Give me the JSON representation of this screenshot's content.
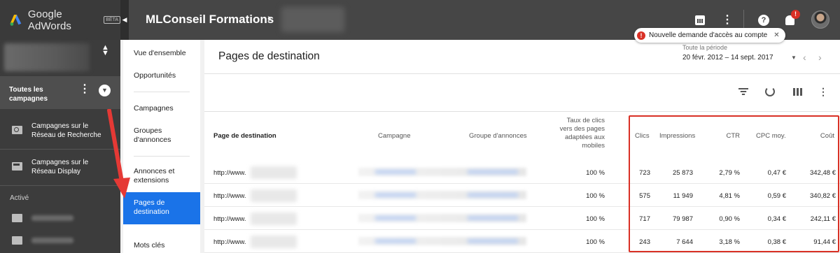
{
  "brand": {
    "name": "Google AdWords",
    "badge": "BÊTA"
  },
  "left_nav": {
    "all_campaigns": "Toutes les campagnes",
    "items": [
      {
        "label": "Campagnes sur le Réseau de Recherche",
        "icon": "search-network-icon"
      },
      {
        "label": "Campagnes sur le Réseau Display",
        "icon": "display-network-icon"
      }
    ],
    "active_section": "Activé"
  },
  "topbar": {
    "account_name": "MLConseil Formations",
    "notification_count": "!",
    "help_label": "?"
  },
  "notification": {
    "text": "Nouvelle demande d'accès au compte"
  },
  "sub_nav": {
    "items": [
      "Vue d'ensemble",
      "Opportunités",
      "Campagnes",
      "Groupes d'annonces",
      "Annonces et extensions",
      "Pages de destination",
      "Mots clés"
    ],
    "active": "Pages de destination"
  },
  "main": {
    "title": "Pages de destination",
    "period_label": "Toute la période",
    "period_value": "20 févr. 2012 – 14 sept. 2017"
  },
  "table": {
    "headers": {
      "page": "Page de destination",
      "campaign": "Campagne",
      "adgroup": "Groupe d'annonces",
      "mobile_ctr": "Taux de clics vers des pages adaptées aux mobiles",
      "clicks": "Clics",
      "impressions": "Impressions",
      "ctr": "CTR",
      "cpc": "CPC moy.",
      "cost": "Coût"
    },
    "rows": [
      {
        "url": "http://www.",
        "mobile": "100 %",
        "clicks": "723",
        "impressions": "25 873",
        "ctr": "2,79 %",
        "cpc": "0,47 €",
        "cost": "342,48 €"
      },
      {
        "url": "http://www.",
        "mobile": "100 %",
        "clicks": "575",
        "impressions": "11 949",
        "ctr": "4,81 %",
        "cpc": "0,59 €",
        "cost": "340,82 €"
      },
      {
        "url": "http://www.",
        "mobile": "100 %",
        "clicks": "717",
        "impressions": "79 987",
        "ctr": "0,90 %",
        "cpc": "0,34 €",
        "cost": "242,11 €"
      },
      {
        "url": "http://www.",
        "mobile": "100 %",
        "clicks": "243",
        "impressions": "7 644",
        "ctr": "3,18 %",
        "cpc": "0,38 €",
        "cost": "91,44 €"
      }
    ]
  },
  "colors": {
    "accent": "#1a73e8",
    "highlight": "#d93025",
    "sidebar": "#3c3c3c",
    "topbar": "#464646"
  }
}
